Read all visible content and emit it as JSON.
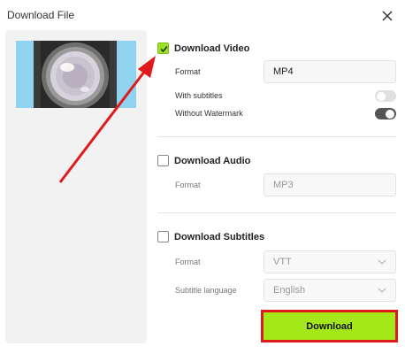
{
  "dialog": {
    "title": "Download File"
  },
  "video": {
    "label": "Download Video",
    "checked": true,
    "format_label": "Format",
    "format_value": "MP4",
    "subtitles_label": "With subtitles",
    "subtitles_on": false,
    "watermark_label": "Without Watermark",
    "watermark_on": true
  },
  "audio": {
    "label": "Download Audio",
    "checked": false,
    "format_label": "Format",
    "format_value": "MP3"
  },
  "subtitles": {
    "label": "Download Subtitles",
    "checked": false,
    "format_label": "Format",
    "format_value": "VTT",
    "language_label": "Subtitle language",
    "language_value": "English"
  },
  "actions": {
    "download_label": "Download"
  },
  "colors": {
    "accent": "#a4e81a",
    "highlight": "#e0191b"
  },
  "icons": [
    "close-icon",
    "checkmark-icon",
    "chevron-down-icon",
    "camera-lens-icon"
  ]
}
